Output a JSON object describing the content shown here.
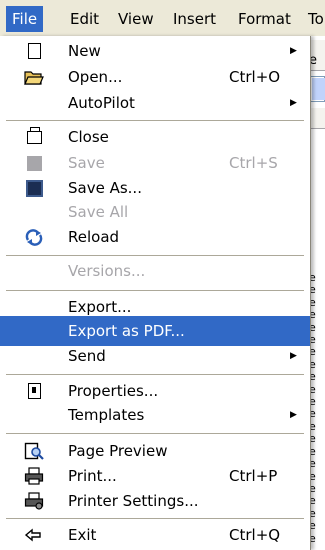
{
  "menubar": {
    "items": [
      {
        "label": "File",
        "active": true
      },
      {
        "label": "Edit",
        "active": false
      },
      {
        "label": "View",
        "active": false
      },
      {
        "label": "Insert",
        "active": false
      },
      {
        "label": "Format",
        "active": false
      },
      {
        "label": "To",
        "active": false
      }
    ]
  },
  "background_document": {
    "partial_text_top": "e",
    "lines": [
      "he",
      "he",
      "he",
      "he",
      "he",
      "he",
      "he",
      "he",
      "he",
      "he",
      "he",
      "he",
      "he",
      "he",
      "he",
      "he",
      "he",
      "he",
      "he",
      "he",
      "he",
      "he"
    ]
  },
  "menu": {
    "items": [
      {
        "label": "New",
        "shortcut": "",
        "submenu": true,
        "disabled": false,
        "icon": "new-document-icon"
      },
      {
        "label": "Open...",
        "shortcut": "Ctrl+O",
        "submenu": false,
        "disabled": false,
        "icon": "open-folder-icon"
      },
      {
        "label": "AutoPilot",
        "shortcut": "",
        "submenu": true,
        "disabled": false,
        "icon": ""
      },
      {
        "label": "Close",
        "shortcut": "",
        "submenu": false,
        "disabled": false,
        "icon": "close-document-icon"
      },
      {
        "label": "Save",
        "shortcut": "Ctrl+S",
        "submenu": false,
        "disabled": true,
        "icon": "save-icon"
      },
      {
        "label": "Save As...",
        "shortcut": "",
        "submenu": false,
        "disabled": false,
        "icon": "save-as-icon"
      },
      {
        "label": "Save All",
        "shortcut": "",
        "submenu": false,
        "disabled": true,
        "icon": ""
      },
      {
        "label": "Reload",
        "shortcut": "",
        "submenu": false,
        "disabled": false,
        "icon": "reload-icon"
      },
      {
        "label": "Versions...",
        "shortcut": "",
        "submenu": false,
        "disabled": true,
        "icon": ""
      },
      {
        "label": "Export...",
        "shortcut": "",
        "submenu": false,
        "disabled": false,
        "icon": ""
      },
      {
        "label": "Export as PDF...",
        "shortcut": "",
        "submenu": false,
        "disabled": false,
        "selected": true,
        "icon": ""
      },
      {
        "label": "Send",
        "shortcut": "",
        "submenu": true,
        "disabled": false,
        "icon": ""
      },
      {
        "label": "Properties...",
        "shortcut": "",
        "submenu": false,
        "disabled": false,
        "icon": "properties-icon"
      },
      {
        "label": "Templates",
        "shortcut": "",
        "submenu": true,
        "disabled": false,
        "icon": ""
      },
      {
        "label": "Page Preview",
        "shortcut": "",
        "submenu": false,
        "disabled": false,
        "icon": "page-preview-icon"
      },
      {
        "label": "Print...",
        "shortcut": "Ctrl+P",
        "submenu": false,
        "disabled": false,
        "icon": "printer-icon"
      },
      {
        "label": "Printer Settings...",
        "shortcut": "",
        "submenu": false,
        "disabled": false,
        "icon": "printer-settings-icon"
      },
      {
        "label": "Exit",
        "shortcut": "Ctrl+Q",
        "submenu": false,
        "disabled": false,
        "icon": "exit-icon"
      }
    ]
  },
  "colors": {
    "selection": "#3169c6",
    "disabled_text": "#a7a6aa",
    "menu_bg": "#ffffff",
    "menubar_bg": "#ece9d8"
  }
}
